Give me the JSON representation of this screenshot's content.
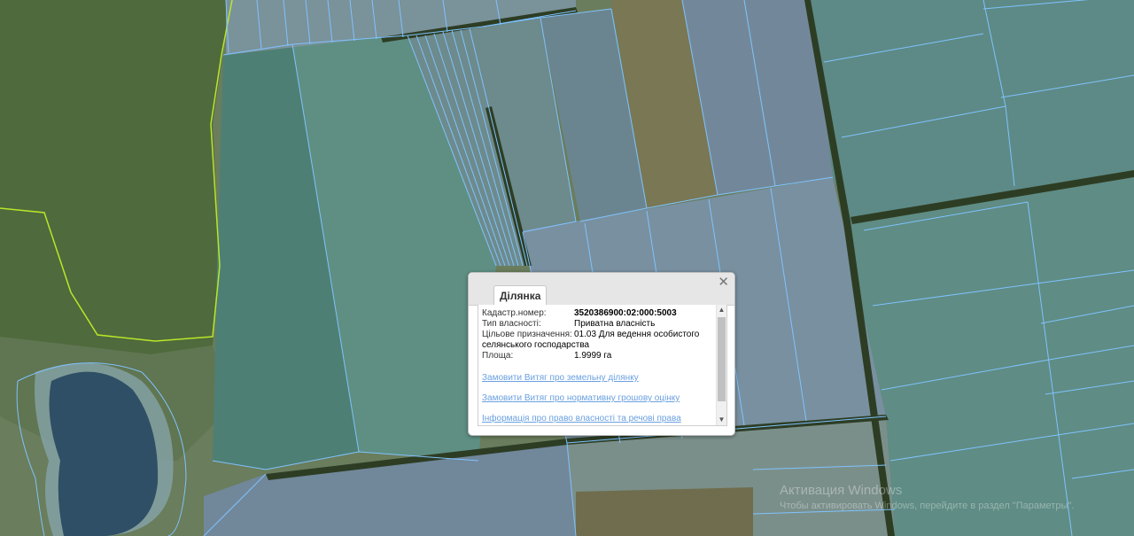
{
  "map": {
    "layer_colors": {
      "parcel_outline": "#7fc3ff",
      "boundary": "#b9e62a",
      "field_a": "#4e7f74",
      "field_b": "#6b8590",
      "field_c": "#7a7755",
      "forest": "#3f5a33",
      "water": "#2f4f66"
    }
  },
  "popup": {
    "tab_label": "Ділянка",
    "close_icon": "close-icon",
    "fields": [
      {
        "label": "Кадастр.номер:",
        "value": "3520386900:02:000:5003"
      },
      {
        "label": "Тип власності:",
        "value": "Приватна власність"
      },
      {
        "label": "Цільове призначення:",
        "value": "01.03 Для ведення особистого"
      },
      {
        "label": "",
        "value": "селянського господарства"
      },
      {
        "label": "Площа:",
        "value": "1.9999 га"
      }
    ],
    "links": [
      "Замовити Витяг про земельну ділянку",
      "Замовити Витяг про нормативну грошову оцінку",
      "Інформація про право власності та речові права"
    ]
  },
  "watermark": {
    "title": "Активация Windows",
    "subtitle": "Чтобы активировать Windows, перейдите в раздел \"Параметры\"."
  }
}
